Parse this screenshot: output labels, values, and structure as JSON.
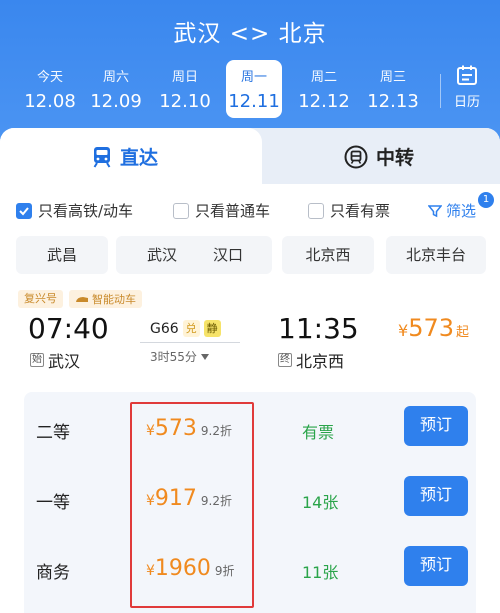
{
  "header": {
    "title": "武汉 <> 北京",
    "dates": [
      {
        "weekday": "今天",
        "date": "12.08",
        "selected": false
      },
      {
        "weekday": "周六",
        "date": "12.09",
        "selected": false
      },
      {
        "weekday": "周日",
        "date": "12.10",
        "selected": false
      },
      {
        "weekday": "周一",
        "date": "12.11",
        "selected": true
      },
      {
        "weekday": "周二",
        "date": "12.12",
        "selected": false
      },
      {
        "weekday": "周三",
        "date": "12.13",
        "selected": false
      }
    ],
    "calendar_label": "日历"
  },
  "tabs": {
    "direct": "直达",
    "transfer": "中转"
  },
  "filters": {
    "options": [
      {
        "label": "只看高铁/动车",
        "checked": true
      },
      {
        "label": "只看普通车",
        "checked": false
      },
      {
        "label": "只看有票",
        "checked": false
      }
    ],
    "filter_label": "筛选",
    "filter_count": "1"
  },
  "stations": [
    "武昌",
    "武汉",
    "汉口",
    "北京西",
    "北京丰台"
  ],
  "train": {
    "tags": [
      "复兴号",
      "智能动车"
    ],
    "depart_time": "07:40",
    "arrive_time": "11:35",
    "train_no": "G66",
    "badge_dui": "兑",
    "badge_jing": "静",
    "duration": "3时55分",
    "depart_mark": "始",
    "depart_station": "武汉",
    "arrive_mark": "终",
    "arrive_station": "北京西",
    "price_symbol": "¥",
    "price_from": "573",
    "price_suffix": "起"
  },
  "seats": [
    {
      "name": "二等",
      "symbol": "¥",
      "price": "573",
      "discount": "9.2折",
      "availability": "有票",
      "button": "预订"
    },
    {
      "name": "一等",
      "symbol": "¥",
      "price": "917",
      "discount": "9.2折",
      "availability": "14张",
      "button": "预订"
    },
    {
      "name": "商务",
      "symbol": "¥",
      "price": "1960",
      "discount": "9折",
      "availability": "11张",
      "button": "预订"
    }
  ],
  "colors": {
    "header_blue": "#3a87ee",
    "accent_blue": "#2f80ed",
    "price_orange": "#f08a1f",
    "available_green": "#2aa44a",
    "highlight_red": "#e03a3a"
  }
}
